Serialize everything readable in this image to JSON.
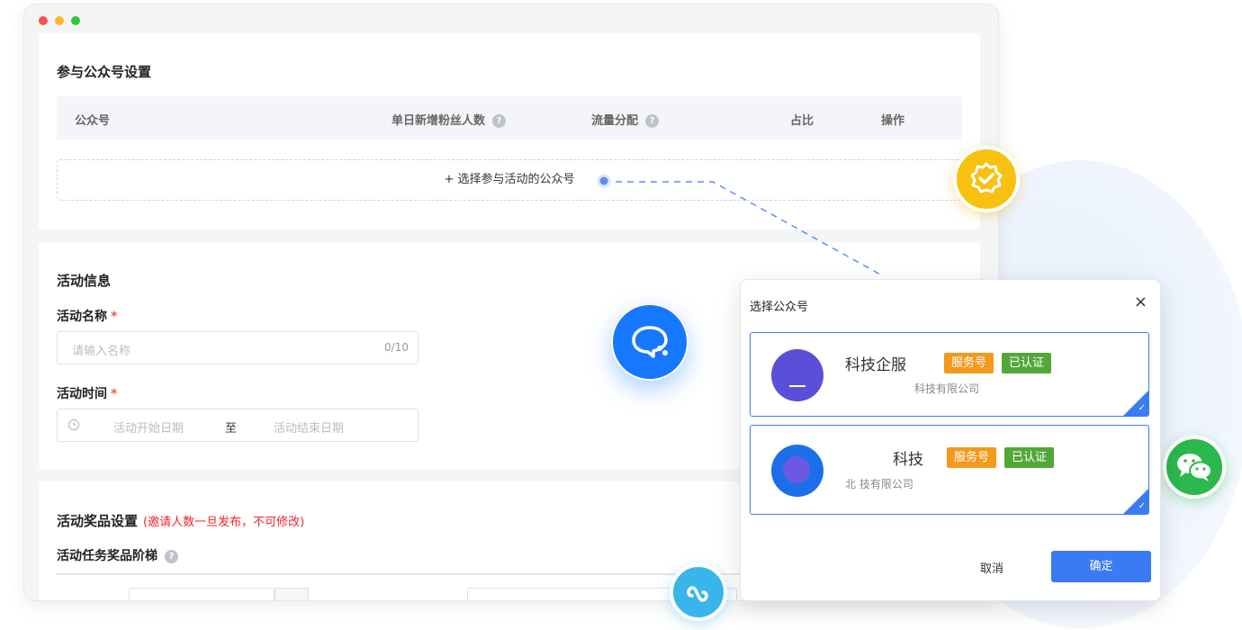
{
  "window": {
    "traffic_lights": [
      "close",
      "minimize",
      "maximize"
    ]
  },
  "account_settings": {
    "title": "参与公众号设置",
    "columns": [
      "公众号",
      "单日新增粉丝人数",
      "流量分配",
      "占比",
      "操作"
    ],
    "help_icon": "?",
    "add_button": "+ 选择参与活动的公众号"
  },
  "activity_info": {
    "title": "活动信息",
    "name_label": "活动名称",
    "name_placeholder": "请输入名称",
    "name_counter": "0/10",
    "time_label": "活动时间",
    "start_placeholder": "活动开始日期",
    "to_label": "至",
    "end_placeholder": "活动结束日期",
    "required_mark": "*"
  },
  "prize_settings": {
    "title": "活动奖品设置",
    "note": "(邀请人数一旦发布，不可修改)",
    "ladder_label": "活动任务奖品阶梯"
  },
  "modal": {
    "title": "选择公众号",
    "close": "×",
    "accounts": [
      {
        "name": "科技企服",
        "tags": [
          "服务号",
          "已认证"
        ],
        "company": "科技有限公司",
        "avatar_color": "#5a4fd8",
        "selected": true
      },
      {
        "name": "科技",
        "tags": [
          "服务号",
          "已认证"
        ],
        "company": "北         技有限公司",
        "avatar_color": "#1c6fe8",
        "selected": true
      }
    ],
    "cancel": "取消",
    "confirm": "确定"
  },
  "decor_icons": [
    "verified-badge-icon",
    "chat-bubble-icon",
    "wechat-icon",
    "mini-program-link-icon"
  ],
  "colors": {
    "primary": "#3a7af2",
    "required": "#f5544d",
    "warning_text": "#f5222d",
    "tag_orange": "#f39a1c",
    "tag_green": "#52a738"
  }
}
